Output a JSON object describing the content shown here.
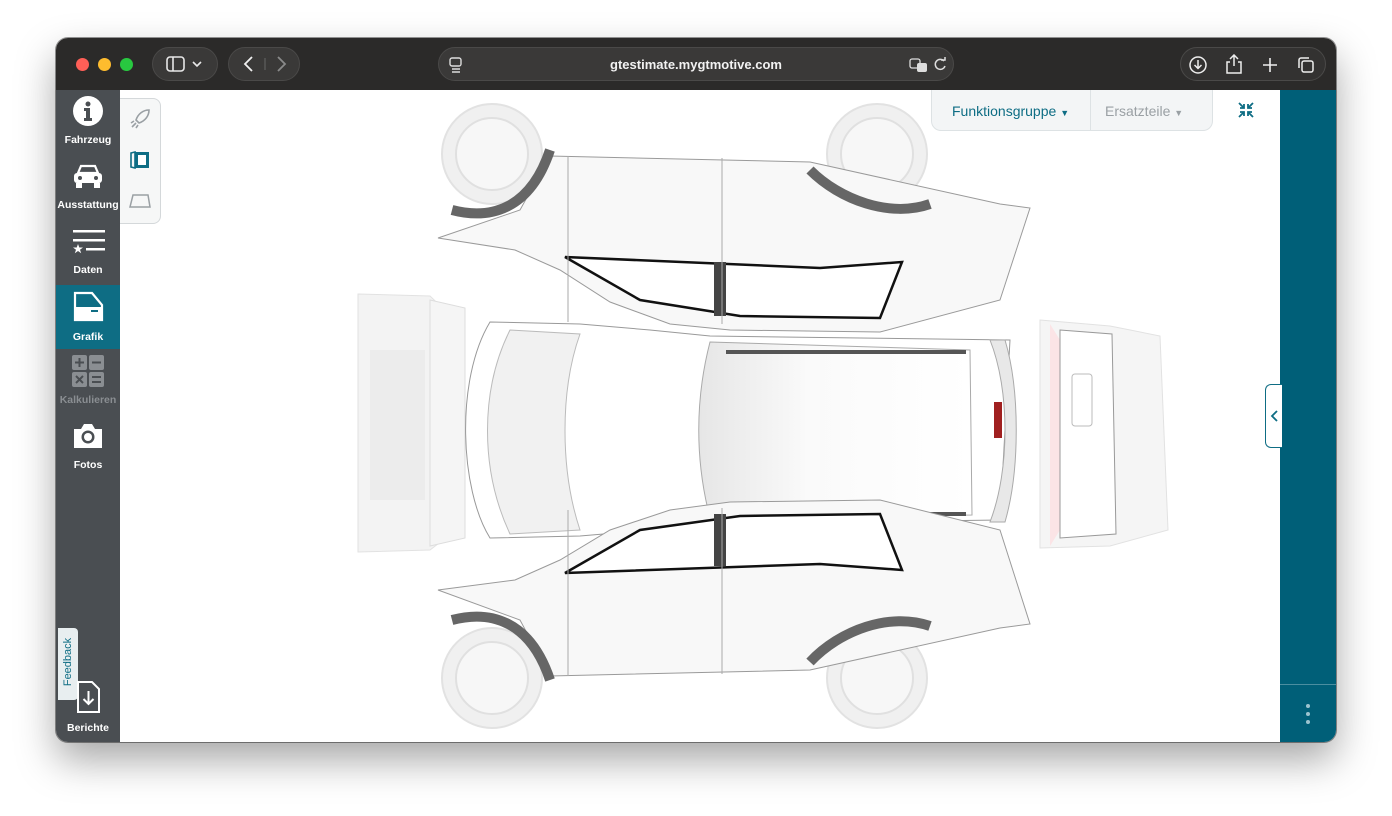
{
  "browser": {
    "url": "gtestimate.mygtmotive.com"
  },
  "sidebar": {
    "items": [
      {
        "label": "Fahrzeug"
      },
      {
        "label": "Ausstattung"
      },
      {
        "label": "Daten"
      },
      {
        "label": "Grafik"
      },
      {
        "label": "Kalkulieren"
      },
      {
        "label": "Fotos"
      }
    ],
    "feedback": "Feedback",
    "reports": "Berichte"
  },
  "toolbar": {
    "group_label": "Funktionsgruppe",
    "parts_label": "Ersatzteile"
  },
  "colors": {
    "accent": "#0e6d84",
    "sidebar": "#4a4e52",
    "right_panel": "#005f78"
  }
}
